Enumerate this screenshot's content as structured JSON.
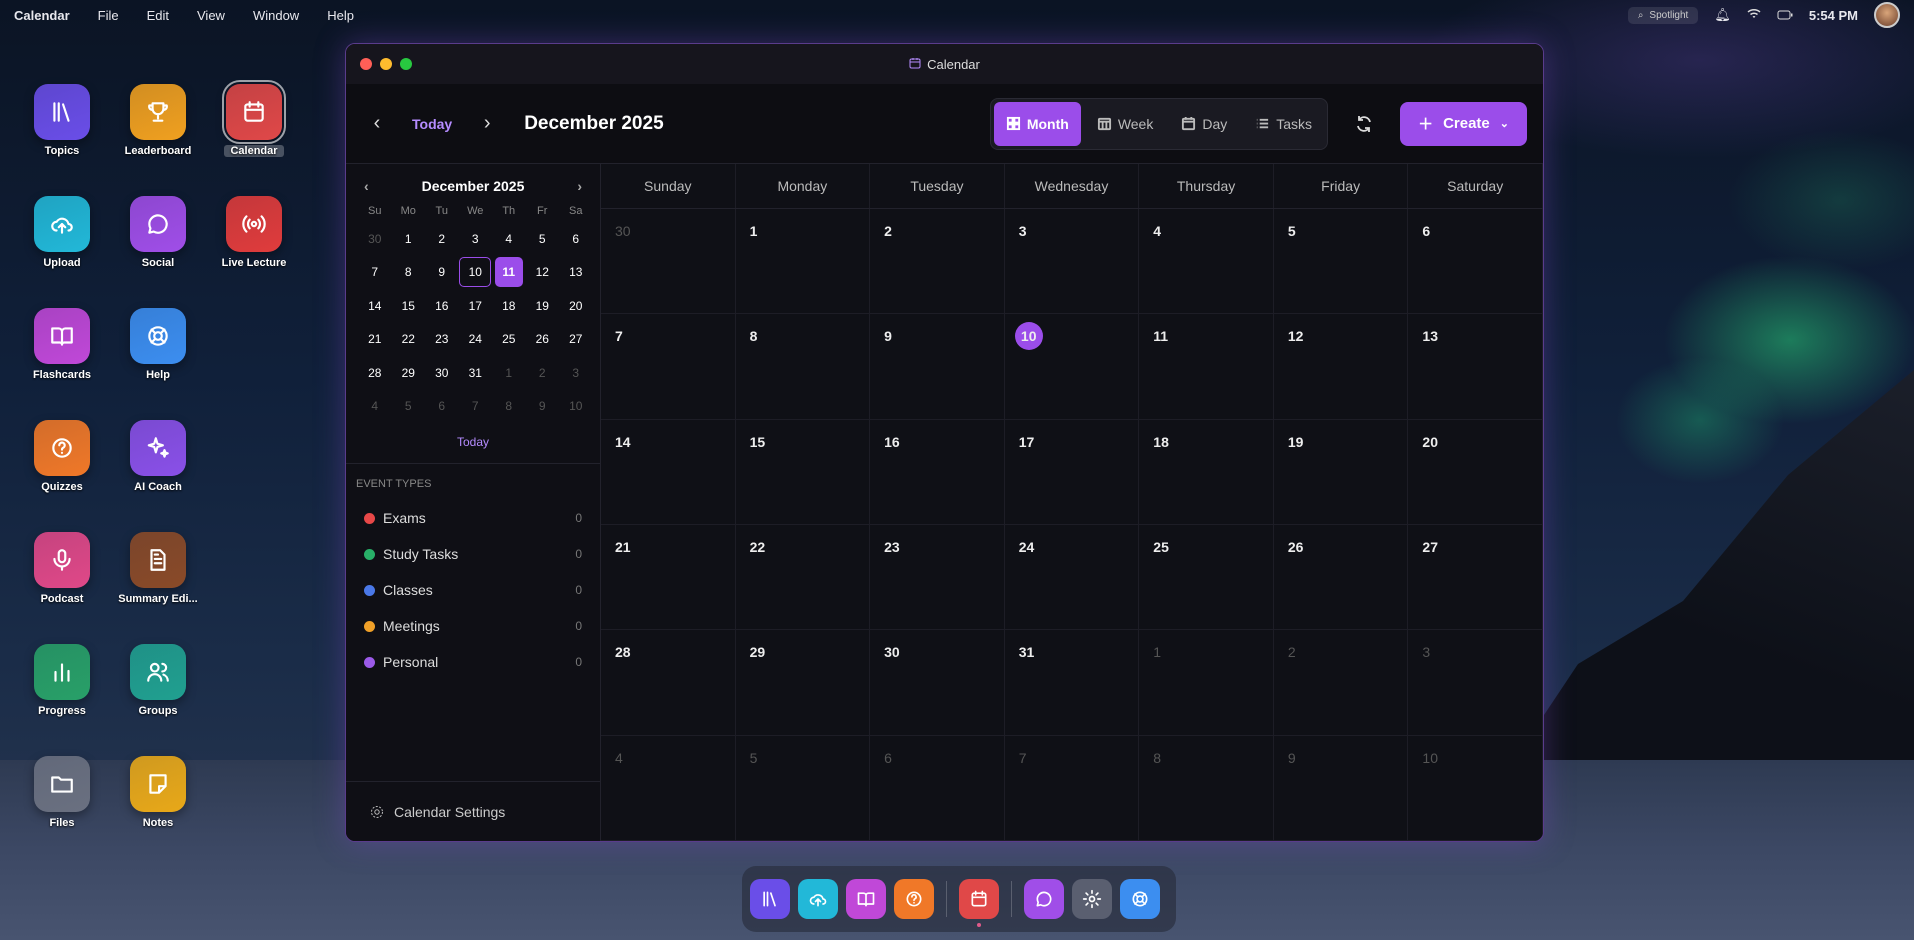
{
  "menubar": {
    "app": "Calendar",
    "items": [
      "File",
      "Edit",
      "View",
      "Window",
      "Help"
    ],
    "spotlight": "Spotlight",
    "time": "5:54 PM"
  },
  "desktop": {
    "icons": [
      {
        "label": "Topics",
        "icon": "library-icon",
        "color": "#6a4ee8"
      },
      {
        "label": "Leaderboard",
        "icon": "trophy-icon",
        "color": "#f0a020"
      },
      {
        "label": "Calendar",
        "icon": "calendar-icon",
        "color": "#e04848"
      },
      {
        "label": "Upload",
        "icon": "upload-cloud-icon",
        "color": "#22b8d8"
      },
      {
        "label": "Social",
        "icon": "chat-bubble-icon",
        "color": "#a04ee8"
      },
      {
        "label": "Live Lecture",
        "icon": "broadcast-icon",
        "color": "#e03c3c"
      },
      {
        "label": "Flashcards",
        "icon": "book-open-icon",
        "color": "#c048d8"
      },
      {
        "label": "Help",
        "icon": "lifebuoy-icon",
        "color": "#3c8ef0"
      },
      {
        "label": "Quizzes",
        "icon": "question-icon",
        "color": "#f07828"
      },
      {
        "label": "AI Coach",
        "icon": "sparkles-icon",
        "color": "#8a50e8"
      },
      {
        "label": "Podcast",
        "icon": "microphone-icon",
        "color": "#e04888"
      },
      {
        "label": "Summary Edi...",
        "icon": "document-icon",
        "color": "#8a4a28"
      },
      {
        "label": "Progress",
        "icon": "bar-chart-icon",
        "color": "#28a068"
      },
      {
        "label": "Groups",
        "icon": "users-icon",
        "color": "#20a090"
      },
      {
        "label": "Files",
        "icon": "folder-icon",
        "color": "#6a7080"
      },
      {
        "label": "Notes",
        "icon": "note-icon",
        "color": "#e8a818"
      }
    ]
  },
  "window": {
    "title": "Calendar",
    "toolbar": {
      "today": "Today",
      "month_title": "December 2025",
      "views": [
        "Month",
        "Week",
        "Day",
        "Tasks"
      ],
      "active_view": "Month",
      "create": "Create"
    },
    "mini": {
      "title": "December 2025",
      "weekdays": [
        "Su",
        "Mo",
        "Tu",
        "We",
        "Th",
        "Fr",
        "Sa"
      ],
      "days": [
        "30",
        "1",
        "2",
        "3",
        "4",
        "5",
        "6",
        "7",
        "8",
        "9",
        "10",
        "11",
        "12",
        "13",
        "14",
        "15",
        "16",
        "17",
        "18",
        "19",
        "20",
        "21",
        "22",
        "23",
        "24",
        "25",
        "26",
        "27",
        "28",
        "29",
        "30",
        "31",
        "1",
        "2",
        "3",
        "4",
        "5",
        "6",
        "7",
        "8",
        "9",
        "10"
      ],
      "today_label": "Today"
    },
    "event_types": {
      "header": "EVENT TYPES",
      "items": [
        {
          "label": "Exams",
          "count": "0",
          "color": "#e84848"
        },
        {
          "label": "Study Tasks",
          "count": "0",
          "color": "#28b068"
        },
        {
          "label": "Classes",
          "count": "0",
          "color": "#4a78e8"
        },
        {
          "label": "Meetings",
          "count": "0",
          "color": "#f0a028"
        },
        {
          "label": "Personal",
          "count": "0",
          "color": "#9b5ae8"
        }
      ]
    },
    "settings": "Calendar Settings",
    "weekdays": [
      "Sunday",
      "Monday",
      "Tuesday",
      "Wednesday",
      "Thursday",
      "Friday",
      "Saturday"
    ],
    "month_days": [
      "30",
      "1",
      "2",
      "3",
      "4",
      "5",
      "6",
      "7",
      "8",
      "9",
      "10",
      "11",
      "12",
      "13",
      "14",
      "15",
      "16",
      "17",
      "18",
      "19",
      "20",
      "21",
      "22",
      "23",
      "24",
      "25",
      "26",
      "27",
      "28",
      "29",
      "30",
      "31",
      "1",
      "2",
      "3",
      "4",
      "5",
      "6",
      "7",
      "8",
      "9",
      "10"
    ]
  },
  "dock": {
    "items": [
      "library-icon",
      "upload-cloud-icon",
      "book-open-icon",
      "question-icon",
      "calendar-icon",
      "chat-bubble-icon",
      "gear-icon",
      "lifebuoy-icon"
    ],
    "colors": [
      "#6a4ee8",
      "#22b8d8",
      "#c048d8",
      "#f07828",
      "#e04848",
      "#a04ee8",
      "#5a5f70",
      "#3c8ef0"
    ]
  },
  "accent": "#9b4dea"
}
